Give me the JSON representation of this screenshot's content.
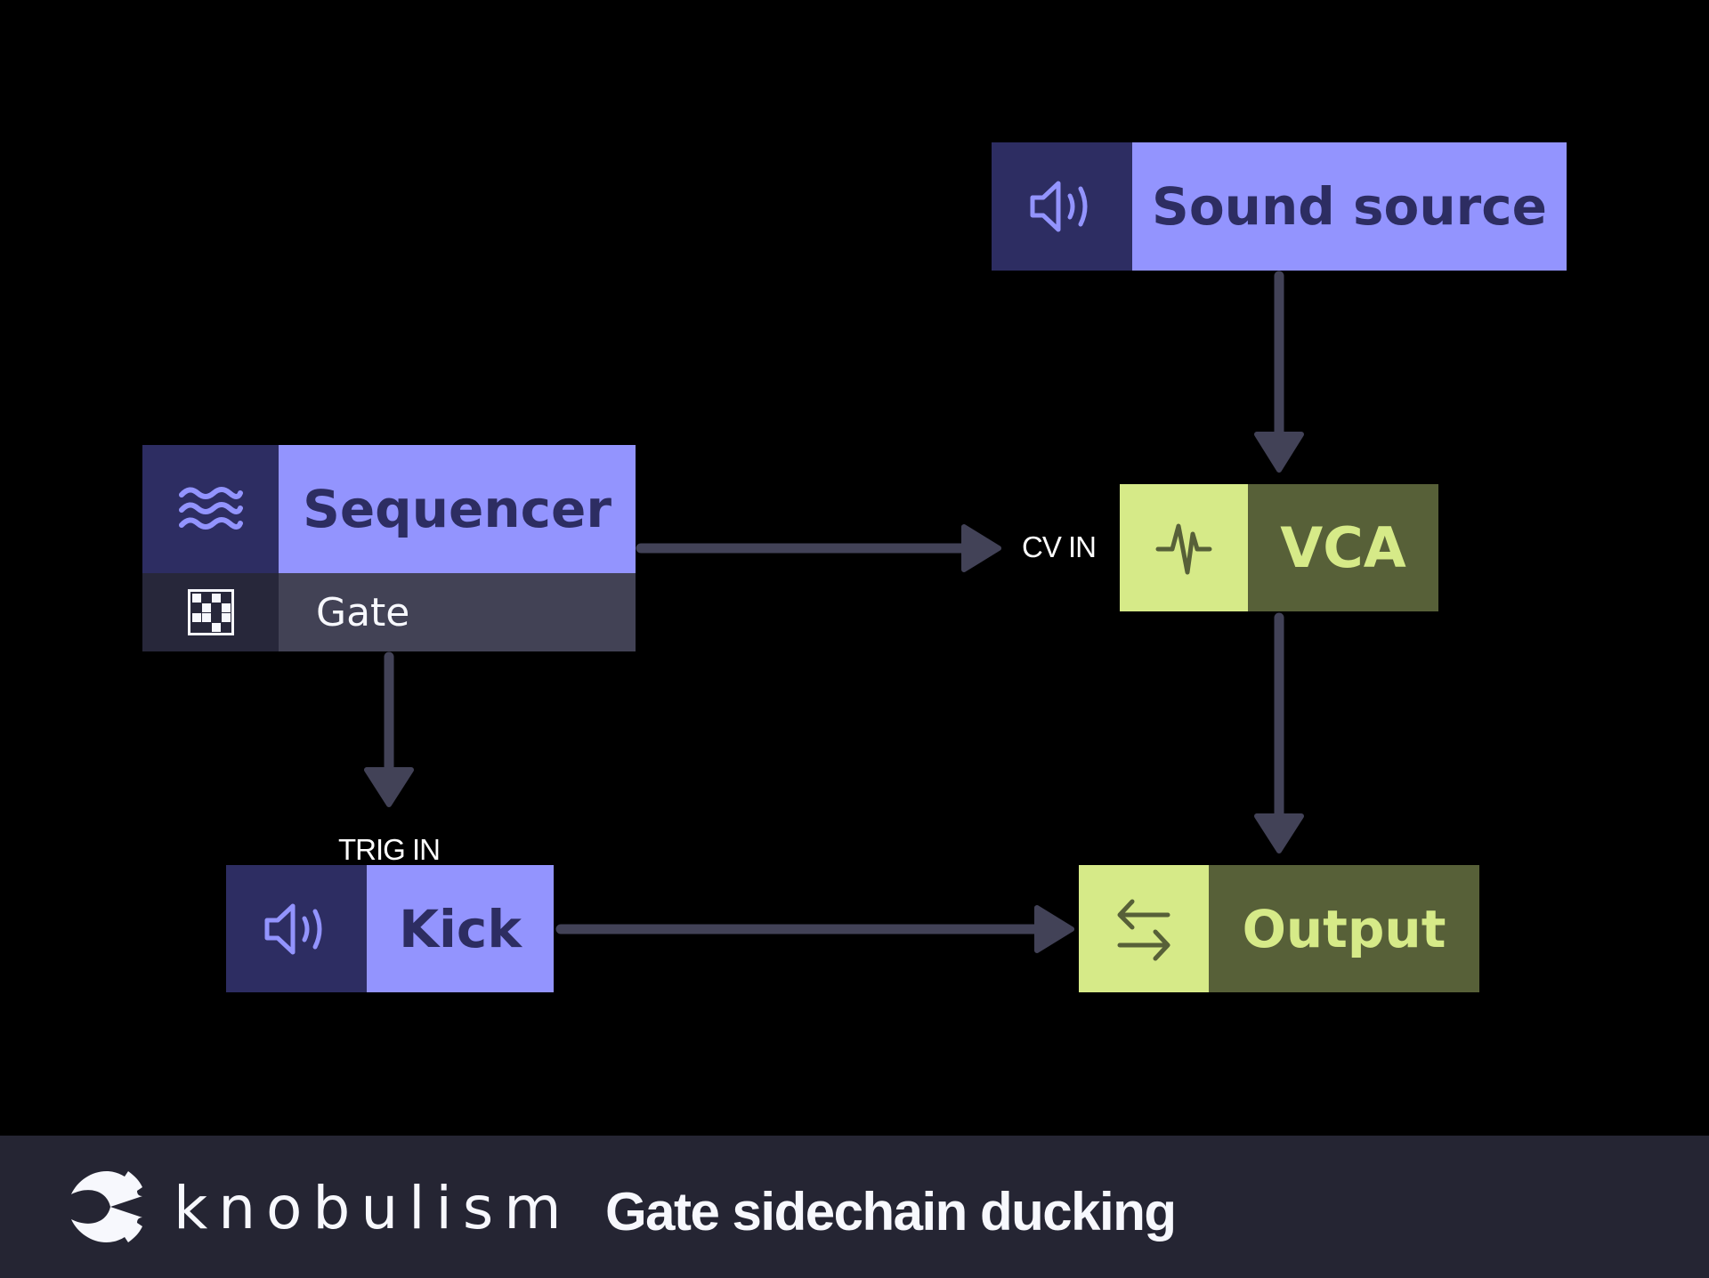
{
  "colors": {
    "background": "#000000",
    "source_dark": "#2d2d62",
    "source_light": "#9394fe",
    "sink_light": "#d6ea88",
    "sink_dark": "#576038",
    "gate_row": "#424255",
    "gate_icon_bg": "#27273a",
    "wire": "#424257",
    "footer": "#252533",
    "footer_text": "#f7f8fd"
  },
  "nodes": {
    "sound_source": {
      "label": "Sound source",
      "icon": "speaker-icon"
    },
    "sequencer": {
      "label": "Sequencer",
      "icon": "waves-icon",
      "output": {
        "label": "Gate",
        "icon": "pattern-grid-icon"
      }
    },
    "vca": {
      "label": "VCA",
      "icon": "pulse-icon"
    },
    "kick": {
      "label": "Kick",
      "icon": "speaker-icon"
    },
    "output": {
      "label": "Output",
      "icon": "swap-arrows-icon"
    }
  },
  "ports": {
    "vca_cv_in": "CV IN",
    "kick_trig_in": "TRIG IN"
  },
  "connections": [
    {
      "from": "Sound source",
      "to": "VCA"
    },
    {
      "from": "Sequencer (Gate)",
      "to": "VCA (CV IN)"
    },
    {
      "from": "Sequencer (Gate)",
      "to": "Kick (TRIG IN)"
    },
    {
      "from": "VCA",
      "to": "Output"
    },
    {
      "from": "Kick",
      "to": "Output"
    }
  ],
  "footer": {
    "brand": "knobulism",
    "title": "Gate sidechain ducking"
  }
}
